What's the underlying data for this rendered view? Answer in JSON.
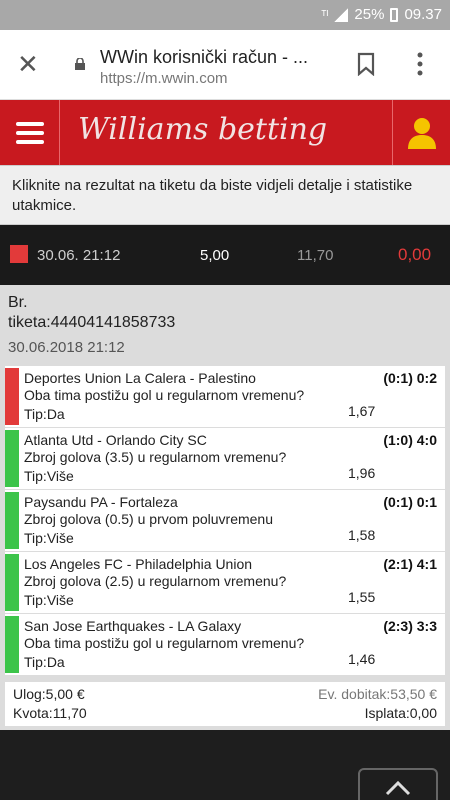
{
  "status_bar": {
    "battery": "25%",
    "time": "09.37"
  },
  "browser": {
    "title": "WWin korisnički račun - ...",
    "url": "https://m.wwin.com"
  },
  "site": {
    "logo_text": "Williams betting"
  },
  "info_banner": "Kliknite na rezultat na tiketu da biste vidjeli detalje i statistike utakmice.",
  "summary": {
    "date": "30.06. 21:12",
    "stake": "5,00",
    "odds": "11,70",
    "win": "0,00",
    "status_color": "#e23a3a"
  },
  "ticket": {
    "br_label": "Br.",
    "number": "tiketa:44404141858733",
    "date": "30.06.2018 21:12",
    "bets": [
      {
        "match": "Deportes Union La Calera - Palestino",
        "market": "Oba tima postižu gol u regularnom vremenu?",
        "tip": "Tip:Da",
        "odd": "1,67",
        "score": "(0:1) 0:2",
        "status": "lost"
      },
      {
        "match": "Atlanta Utd - Orlando City SC",
        "market": "Zbroj golova (3.5) u regularnom vremenu?",
        "tip": "Tip:Više",
        "odd": "1,96",
        "score": "(1:0) 4:0",
        "status": "won"
      },
      {
        "match": "Paysandu PA - Fortaleza",
        "market": "Zbroj golova (0.5) u prvom poluvremenu",
        "tip": "Tip:Više",
        "odd": "1,58",
        "score": "(0:1) 0:1",
        "status": "won"
      },
      {
        "match": "Los Angeles FC - Philadelphia Union",
        "market": "Zbroj golova (2.5) u regularnom vremenu?",
        "tip": "Tip:Više",
        "odd": "1,55",
        "score": "(2:1) 4:1",
        "status": "won"
      },
      {
        "match": "San Jose Earthquakes - LA Galaxy",
        "market": "Oba tima postižu gol u regularnom vremenu?",
        "tip": "Tip:Da",
        "odd": "1,46",
        "score": "(2:3) 3:3",
        "status": "won"
      }
    ],
    "totals": {
      "stake": "Ulog:5,00 €",
      "odds": "Kvota:11,70",
      "expected": "Ev. dobitak:53,50 €",
      "payout": "Isplata:0,00"
    }
  },
  "colors": {
    "brand_red": "#c8191f",
    "lost": "#e23a3a",
    "won": "#3cc44a"
  }
}
